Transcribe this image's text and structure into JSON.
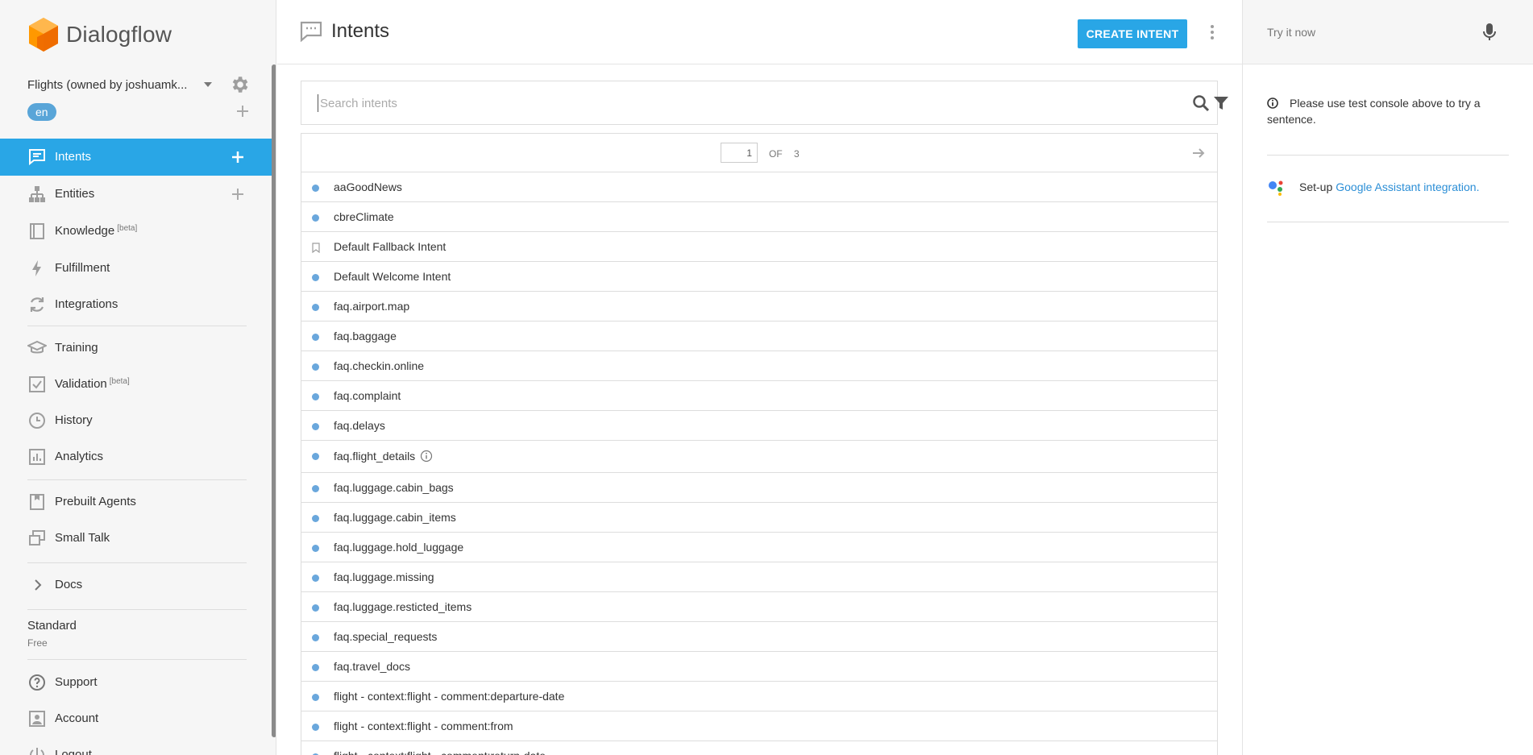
{
  "app": {
    "name": "Dialogflow"
  },
  "agent": {
    "name": "Flights (owned by joshuamk...",
    "language": "en"
  },
  "nav": [
    {
      "id": "intents",
      "label": "Intents",
      "badge": "",
      "active": true,
      "add": true
    },
    {
      "id": "entities",
      "label": "Entities",
      "badge": "",
      "active": false,
      "add": true
    },
    {
      "id": "knowledge",
      "label": "Knowledge",
      "badge": "[beta]",
      "active": false,
      "add": false
    },
    {
      "id": "fulfillment",
      "label": "Fulfillment",
      "badge": "",
      "active": false,
      "add": false
    },
    {
      "id": "integrations",
      "label": "Integrations",
      "badge": "",
      "active": false,
      "add": false
    },
    {
      "id": "training",
      "label": "Training",
      "badge": "",
      "active": false,
      "add": false
    },
    {
      "id": "validation",
      "label": "Validation",
      "badge": "[beta]",
      "active": false,
      "add": false
    },
    {
      "id": "history",
      "label": "History",
      "badge": "",
      "active": false,
      "add": false
    },
    {
      "id": "analytics",
      "label": "Analytics",
      "badge": "",
      "active": false,
      "add": false
    },
    {
      "id": "prebuilt",
      "label": "Prebuilt Agents",
      "badge": "",
      "active": false,
      "add": false
    },
    {
      "id": "smalltalk",
      "label": "Small Talk",
      "badge": "",
      "active": false,
      "add": false
    },
    {
      "id": "docs",
      "label": "Docs",
      "badge": "",
      "active": false,
      "add": false
    },
    {
      "id": "support",
      "label": "Support",
      "badge": "",
      "active": false,
      "add": false
    },
    {
      "id": "account",
      "label": "Account",
      "badge": "",
      "active": false,
      "add": false
    },
    {
      "id": "logout",
      "label": "Logout",
      "badge": "",
      "active": false,
      "add": false
    }
  ],
  "plan": {
    "name": "Standard",
    "tier": "Free"
  },
  "main": {
    "title": "Intents",
    "create_label": "CREATE INTENT",
    "search_placeholder": "Search intents",
    "pager": {
      "current": "1",
      "of_label": "OF",
      "total": "3"
    }
  },
  "intents": [
    {
      "name": "aaGoodNews",
      "kind": "dot"
    },
    {
      "name": "cbreClimate",
      "kind": "dot"
    },
    {
      "name": "Default Fallback Intent",
      "kind": "bookmark"
    },
    {
      "name": "Default Welcome Intent",
      "kind": "dot"
    },
    {
      "name": "faq.airport.map",
      "kind": "dot"
    },
    {
      "name": "faq.baggage",
      "kind": "dot"
    },
    {
      "name": "faq.checkin.online",
      "kind": "dot"
    },
    {
      "name": "faq.complaint",
      "kind": "dot"
    },
    {
      "name": "faq.delays",
      "kind": "dot"
    },
    {
      "name": "faq.flight_details",
      "kind": "dot",
      "info": true
    },
    {
      "name": "faq.luggage.cabin_bags",
      "kind": "dot"
    },
    {
      "name": "faq.luggage.cabin_items",
      "kind": "dot"
    },
    {
      "name": "faq.luggage.hold_luggage",
      "kind": "dot"
    },
    {
      "name": "faq.luggage.missing",
      "kind": "dot"
    },
    {
      "name": "faq.luggage.resticted_items",
      "kind": "dot"
    },
    {
      "name": "faq.special_requests",
      "kind": "dot"
    },
    {
      "name": "faq.travel_docs",
      "kind": "dot"
    },
    {
      "name": "flight - context:flight - comment:departure-date",
      "kind": "dot"
    },
    {
      "name": "flight - context:flight - comment:from",
      "kind": "dot"
    },
    {
      "name": "flight - context:flight - comment:return-date",
      "kind": "dot"
    }
  ],
  "right": {
    "try_placeholder": "Try it now",
    "notice": "Please use test console above to try a sentence.",
    "ga_prefix": "Set-up",
    "ga_link": "Google Assistant integration."
  },
  "colors": {
    "accent": "#29a6e6",
    "dot": "#6aa7dc",
    "link": "#2b8ed6",
    "logo": "#f57c00"
  }
}
